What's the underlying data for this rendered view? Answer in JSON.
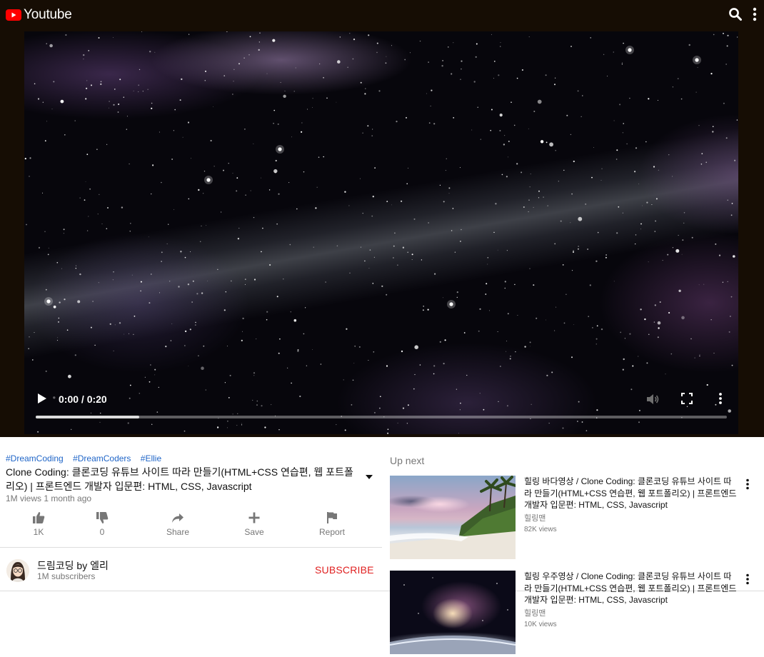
{
  "app": {
    "logo_text": "Youtube",
    "brand_color": "#ff0000"
  },
  "header": {
    "search_icon": "search-icon",
    "more_icon": "more-vertical-icon"
  },
  "player": {
    "time_display": "0:00 / 0:20",
    "progress": 0.15,
    "controls": [
      "play-icon",
      "volume-muted-icon",
      "fullscreen-icon",
      "more-vertical-icon"
    ]
  },
  "video_info": {
    "hashtags": [
      "#DreamCoding",
      "#DreamCoders",
      "#Ellie"
    ],
    "title": "Clone Coding: 클론코딩 유튜브 사이트 따라 만들기(HTML+CSS 연습편, 웹 포트폴리오) | 프론트엔드 개발자 입문편: HTML, CSS, Javascript",
    "meta": "1M views 1 month ago",
    "actions": [
      {
        "label": "1K",
        "icon": "thumbs-up-icon"
      },
      {
        "label": "0",
        "icon": "thumbs-down-icon"
      },
      {
        "label": "Share",
        "icon": "share-icon"
      },
      {
        "label": "Save",
        "icon": "plus-icon"
      },
      {
        "label": "Report",
        "icon": "flag-icon"
      }
    ]
  },
  "channel": {
    "name": "드림코딩 by 엘리",
    "subscribers": "1M subscribers",
    "subscribe_label": "SUBSCRIBE",
    "subscribe_color": "#e02020"
  },
  "up_next": {
    "label": "Up next",
    "items": [
      {
        "title": "힐링 바다영상 / Clone Coding: 클론코딩 유튜브 사이트 따라 만들기(HTML+CSS 연습편, 웹 포트폴리오) | 프론트엔드 개발자 입문편: HTML, CSS, Javascript",
        "channel": "힐링맨",
        "views": "82K views"
      },
      {
        "title": "힐링 우주영상 / Clone Coding: 클론코딩 유튜브 사이트 따라 만들기(HTML+CSS 연습편, 웹 포트폴리오) | 프론트엔드 개발자 입문편: HTML, CSS, Javascript",
        "channel": "힐링맨",
        "views": "10K views"
      }
    ]
  }
}
